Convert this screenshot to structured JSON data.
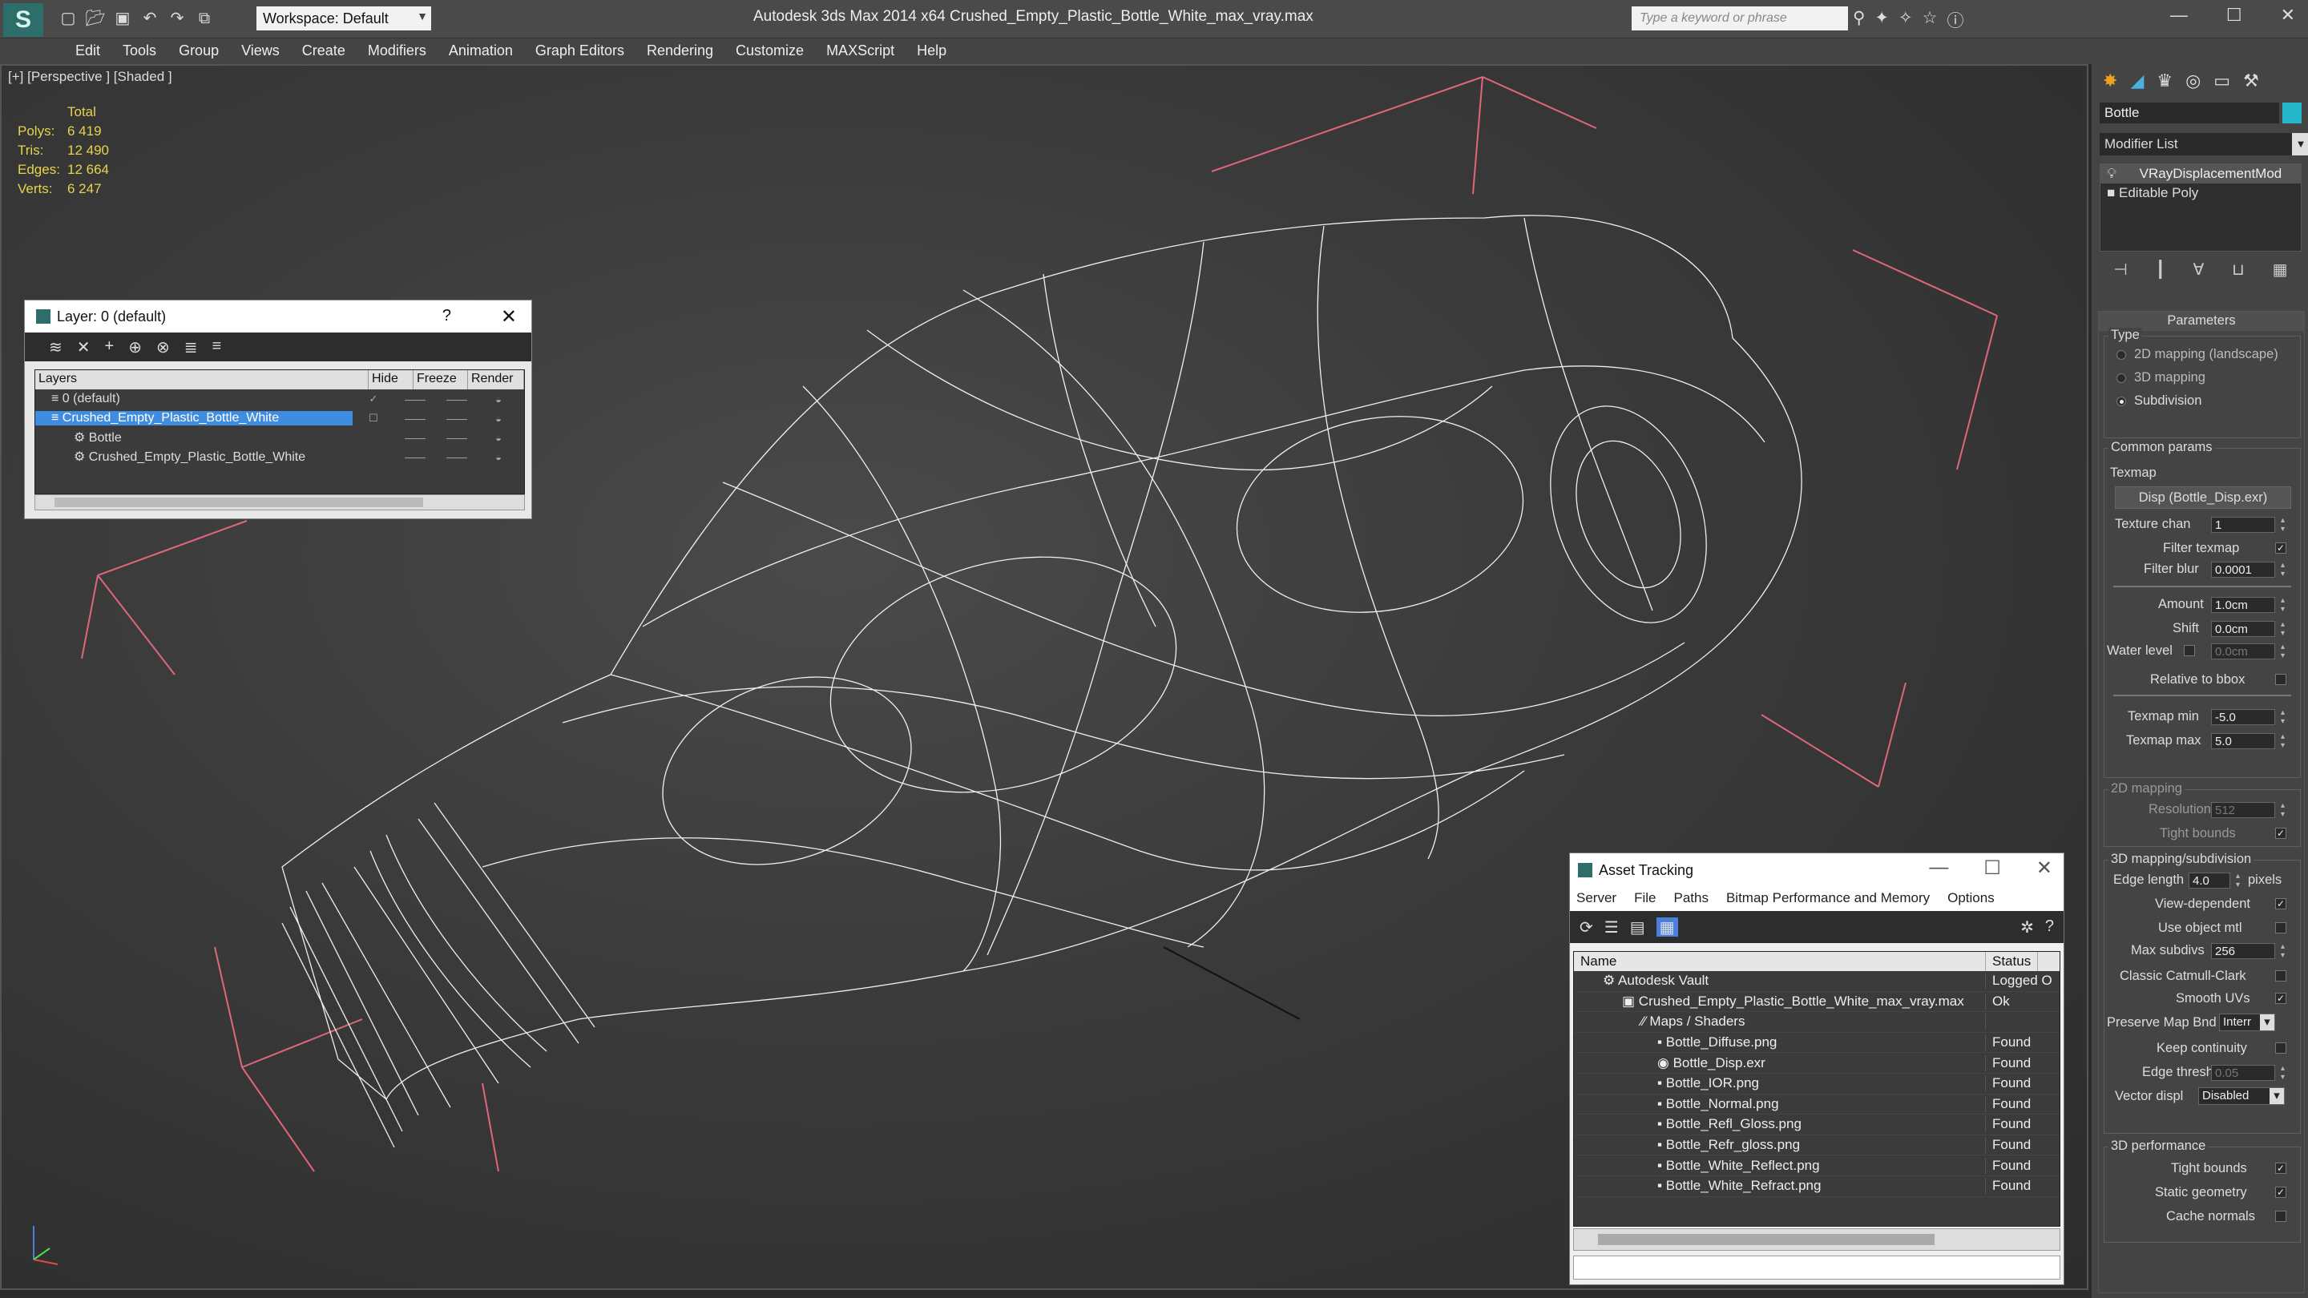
{
  "app": {
    "logo": "S",
    "workspace": "Workspace: Default",
    "title": "Autodesk 3ds Max 2014 x64      Crushed_Empty_Plastic_Bottle_White_max_vray.max",
    "search_placeholder": "Type a keyword or phrase"
  },
  "menu": [
    "Edit",
    "Tools",
    "Group",
    "Views",
    "Create",
    "Modifiers",
    "Animation",
    "Graph Editors",
    "Rendering",
    "Customize",
    "MAXScript",
    "Help"
  ],
  "viewport": {
    "label": "[+] [Perspective ] [Shaded ]",
    "stats": {
      "header": "Total",
      "rows": [
        {
          "k": "Polys:",
          "v": "6 419"
        },
        {
          "k": "Tris:",
          "v": "12 490"
        },
        {
          "k": "Edges:",
          "v": "12 664"
        },
        {
          "k": "Verts:",
          "v": "6 247"
        }
      ]
    }
  },
  "layer_window": {
    "title": "Layer: 0 (default)",
    "help": "?",
    "close": "✕",
    "columns": [
      "Layers",
      "Hide",
      "Freeze",
      "Render"
    ],
    "rows": [
      {
        "name": "0 (default)",
        "indent": 1,
        "selected": false
      },
      {
        "name": "Crushed_Empty_Plastic_Bottle_White",
        "indent": 1,
        "selected": true
      },
      {
        "name": "Bottle",
        "indent": 2,
        "selected": false
      },
      {
        "name": "Crushed_Empty_Plastic_Bottle_White",
        "indent": 2,
        "selected": false
      }
    ]
  },
  "asset_tracking": {
    "title": "Asset Tracking",
    "menu": [
      "Server",
      "File",
      "Paths",
      "Bitmap Performance and Memory",
      "Options"
    ],
    "columns": [
      "Name",
      "Status"
    ],
    "rows": [
      {
        "name": "Autodesk Vault",
        "indent": 1,
        "status": "Logged O"
      },
      {
        "name": "Crushed_Empty_Plastic_Bottle_White_max_vray.max",
        "indent": 2,
        "status": "Ok"
      },
      {
        "name": "Maps / Shaders",
        "indent": 3,
        "status": ""
      },
      {
        "name": "Bottle_Diffuse.png",
        "indent": 4,
        "status": "Found"
      },
      {
        "name": "Bottle_Disp.exr",
        "indent": 4,
        "status": "Found"
      },
      {
        "name": "Bottle_IOR.png",
        "indent": 4,
        "status": "Found"
      },
      {
        "name": "Bottle_Normal.png",
        "indent": 4,
        "status": "Found"
      },
      {
        "name": "Bottle_Refl_Gloss.png",
        "indent": 4,
        "status": "Found"
      },
      {
        "name": "Bottle_Refr_gloss.png",
        "indent": 4,
        "status": "Found"
      },
      {
        "name": "Bottle_White_Reflect.png",
        "indent": 4,
        "status": "Found"
      },
      {
        "name": "Bottle_White_Refract.png",
        "indent": 4,
        "status": "Found"
      }
    ]
  },
  "command_panel": {
    "object_name": "Bottle",
    "color": "#25b6c9",
    "modifier_list": "Modifier List",
    "stack": [
      "VRayDisplacementMod",
      "Editable Poly"
    ],
    "params": {
      "header": "Parameters",
      "type_label": "Type",
      "type_options": [
        "2D mapping (landscape)",
        "3D mapping",
        "Subdivision"
      ],
      "common": "Common params",
      "texmap": "Texmap",
      "texmap_btn": "Disp (Bottle_Disp.exr)",
      "texture_chan": "Texture chan",
      "texture_chan_v": "1",
      "filter_texmap": "Filter texmap",
      "filter_blur": "Filter blur",
      "filter_blur_v": "0.0001",
      "amount": "Amount",
      "amount_v": "1.0cm",
      "shift": "Shift",
      "shift_v": "0.0cm",
      "water": "Water level",
      "water_v": "0.0cm",
      "relative": "Relative to bbox",
      "tmin": "Texmap min",
      "tmin_v": "-5.0",
      "tmax": "Texmap max",
      "tmax_v": "5.0",
      "g2d": "2D mapping",
      "resolution": "Resolution",
      "resolution_v": "512",
      "tight": "Tight bounds",
      "g3d": "3D mapping/subdivision",
      "edge_len": "Edge length",
      "edge_len_v": "4.0",
      "pixels": "pixels",
      "view_dep": "View-dependent",
      "use_obj": "Use object mtl",
      "max_subdivs": "Max subdivs",
      "max_subdivs_v": "256",
      "catmull": "Classic Catmull-Clark",
      "smooth_uv": "Smooth UVs",
      "preserve": "Preserve Map Bnd",
      "preserve_v": "Interr",
      "keep": "Keep continuity",
      "edge_thresh": "Edge thresh",
      "edge_thresh_v": "0.05",
      "vector": "Vector displ",
      "vector_v": "Disabled",
      "gperf": "3D performance",
      "tight2": "Tight bounds",
      "static": "Static geometry",
      "cache": "Cache normals"
    }
  }
}
